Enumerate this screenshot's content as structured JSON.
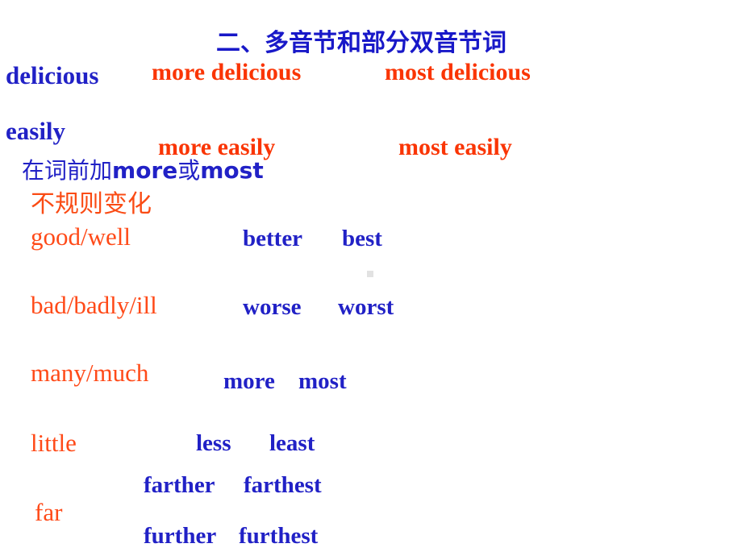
{
  "slide": {
    "title": "二、多音节和部分双音节词",
    "regular": {
      "rows": [
        {
          "base": "delicious",
          "comparative": "more delicious",
          "superlative": "most delicious"
        },
        {
          "base": "easily",
          "comparative": "more easily",
          "superlative": "most easily"
        }
      ],
      "rule_prefix": "在词前加",
      "rule_more": "more",
      "rule_conj": "或",
      "rule_most": "most",
      "rule_full": "在词前加more或most"
    },
    "irregular": {
      "heading": "不规则变化",
      "rows": [
        {
          "base": "good/well",
          "comparative": "better",
          "superlative": "best"
        },
        {
          "base": "bad/badly/ill",
          "comparative": "worse",
          "superlative": "worst"
        },
        {
          "base": "many/much",
          "comparative": "more",
          "superlative": "most"
        },
        {
          "base": "little",
          "comparative": "less",
          "superlative": "least"
        },
        {
          "base": "far",
          "comparative": "farther",
          "superlative": "farthest",
          "comparative_alt": "further",
          "superlative_alt": "furthest"
        }
      ]
    },
    "colors": {
      "title_blue": "#1818c8",
      "base_blue": "#2121c6",
      "form_red": "#fa3504",
      "section_red": "#fa4b14",
      "irregular_word_red": "#ff4a18",
      "background": "#ffffff"
    }
  }
}
